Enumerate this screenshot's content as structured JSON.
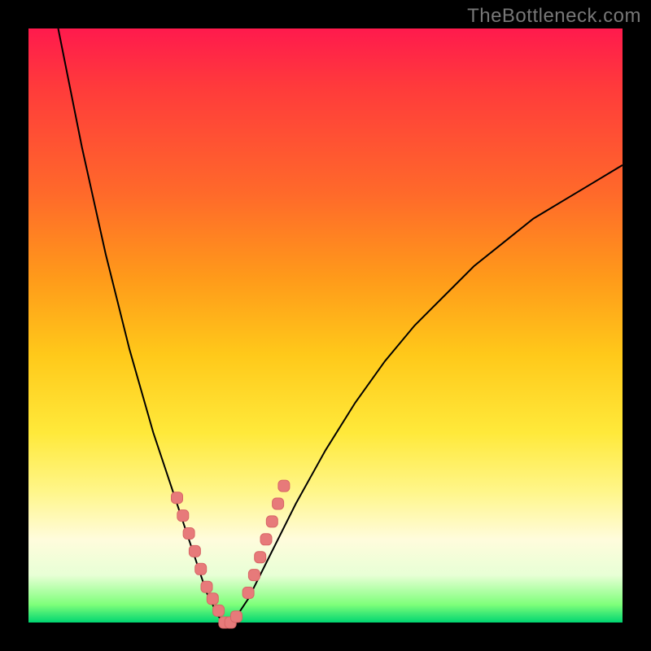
{
  "watermark": "TheBottleneck.com",
  "chart_data": {
    "type": "line",
    "title": "",
    "xlabel": "",
    "ylabel": "",
    "xlim": [
      0,
      100
    ],
    "ylim": [
      0,
      100
    ],
    "grid": false,
    "series": [
      {
        "name": "curve",
        "x": [
          5,
          7,
          9,
          11,
          13,
          15,
          17,
          19,
          21,
          23,
          25,
          26,
          27,
          28,
          29,
          30,
          31,
          32,
          33,
          34,
          35,
          37,
          40,
          45,
          50,
          55,
          60,
          65,
          70,
          75,
          80,
          85,
          90,
          95,
          100
        ],
        "y": [
          100,
          90,
          80,
          71,
          62,
          54,
          46,
          39,
          32,
          26,
          20,
          17,
          14,
          11,
          8,
          5,
          3,
          1,
          0,
          0,
          1,
          4,
          10,
          20,
          29,
          37,
          44,
          50,
          55,
          60,
          64,
          68,
          71,
          74,
          77
        ]
      },
      {
        "name": "markers",
        "x": [
          25,
          26,
          27,
          28,
          29,
          30,
          31,
          32,
          33,
          34,
          35,
          37,
          38,
          39,
          40,
          41,
          42,
          43
        ],
        "y": [
          21,
          18,
          15,
          12,
          9,
          6,
          4,
          2,
          0,
          0,
          1,
          5,
          8,
          11,
          14,
          17,
          20,
          23
        ]
      }
    ],
    "gradient_stops": [
      {
        "pos": 0.0,
        "color": "#ff1a4d"
      },
      {
        "pos": 0.1,
        "color": "#ff3b3b"
      },
      {
        "pos": 0.28,
        "color": "#ff6a2a"
      },
      {
        "pos": 0.42,
        "color": "#ff9a1a"
      },
      {
        "pos": 0.55,
        "color": "#ffc91a"
      },
      {
        "pos": 0.68,
        "color": "#ffe93a"
      },
      {
        "pos": 0.78,
        "color": "#fff68a"
      },
      {
        "pos": 0.86,
        "color": "#fffcdc"
      },
      {
        "pos": 0.92,
        "color": "#e8ffd6"
      },
      {
        "pos": 0.97,
        "color": "#7eff7a"
      },
      {
        "pos": 1.0,
        "color": "#00d571"
      }
    ]
  }
}
